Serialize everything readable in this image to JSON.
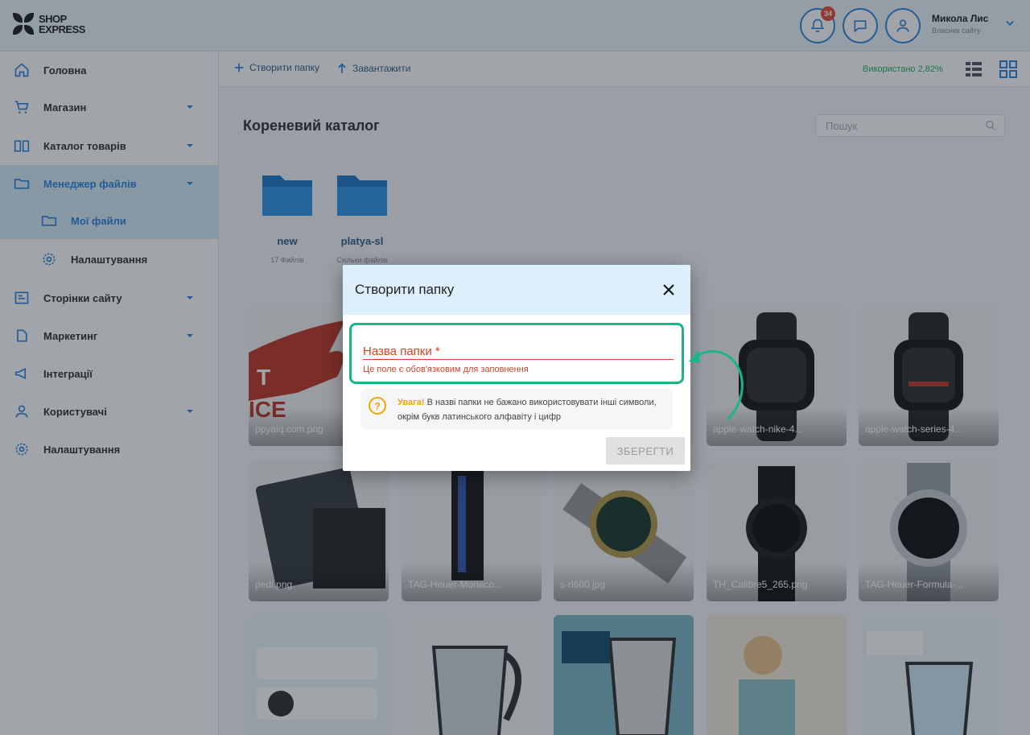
{
  "header": {
    "logo_line1": "SHOP",
    "logo_line2": "EXPRESS",
    "notifications_count": "34",
    "user_name": "Микола Лис",
    "user_sub": "Власник сайту",
    "accent": "#2e86de"
  },
  "sidebar": {
    "items": [
      {
        "label": "Головна",
        "icon": "home-icon"
      },
      {
        "label": "Магазин",
        "icon": "cart-icon"
      },
      {
        "label": "Каталог товарів",
        "icon": "book-icon"
      },
      {
        "label": "Менеджер файлів",
        "icon": "folder-icon"
      },
      {
        "label": "Мої файли",
        "icon": "folder-open-icon"
      },
      {
        "label": "Налаштування",
        "icon": "gear-icon"
      },
      {
        "label": "Сторінки сайту",
        "icon": "pages-icon"
      },
      {
        "label": "Маркетинг",
        "icon": "tag-icon"
      },
      {
        "label": "Інтеграції",
        "icon": "megaphone-icon"
      },
      {
        "label": "Користувачі",
        "icon": "users-icon"
      },
      {
        "label": "Налаштування",
        "icon": "gear-icon"
      }
    ]
  },
  "toolbar": {
    "create_folder": "Створити папку",
    "upload": "Завантажити",
    "usage": "Використано 2,82%"
  },
  "content": {
    "title": "Кореневий каталог",
    "search_placeholder": "Пошук",
    "folders": [
      {
        "name": "new",
        "count": "17 Файлів"
      },
      {
        "name": "platya-sl",
        "count": "Скільки файлів"
      }
    ],
    "tiles": [
      {
        "caption": "ppyaiq.com.png"
      },
      {
        "caption": ""
      },
      {
        "caption": ""
      },
      {
        "caption": "apple-watch-nike-4..."
      },
      {
        "caption": "apple-watch-series-4..."
      },
      {
        "caption": "pedi.png"
      },
      {
        "caption": "TAG-Heuer-Monaco..."
      },
      {
        "caption": "s-rl600.jpg"
      },
      {
        "caption": "TH_Calibre5_265.png"
      },
      {
        "caption": "TAG-Heuer-Formula-..."
      },
      {
        "caption": ""
      },
      {
        "caption": ""
      },
      {
        "caption": ""
      },
      {
        "caption": ""
      },
      {
        "caption": ""
      }
    ]
  },
  "modal": {
    "title": "Створити папку",
    "field_label": "Назва папки *",
    "field_error": "Це поле є обов'язковим для заповнення",
    "warn_strong": "Увага!",
    "warn_text": " В назві папки не бажано використовувати інші символи, окрім букв латинського алфавіту і цифр",
    "save": "ЗБЕРЕГТИ",
    "highlight_color": "#1db588",
    "error_color": "#d9412a"
  }
}
